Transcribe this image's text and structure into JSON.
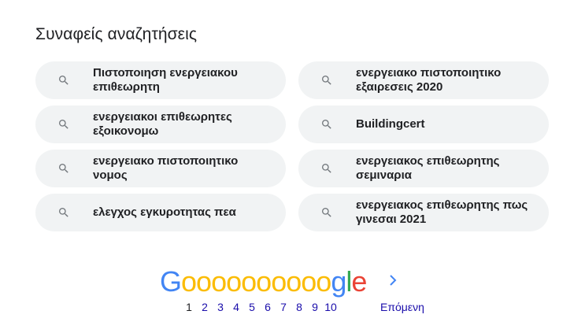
{
  "related": {
    "heading": "Συναφείς αναζητήσεις",
    "items": [
      {
        "label": "Πιστοποιηση ενεργειακου επιθεωρητη"
      },
      {
        "label": "ενεργειακο πιστοποιητικο εξαιρεσεις 2020"
      },
      {
        "label": "ενεργειακοι επιθεωρητες εξοικονομω"
      },
      {
        "label": "Buildingcert"
      },
      {
        "label": "ενεργειακο πιστοποιητικο νομος"
      },
      {
        "label": "ενεργειακος επιθεωρητης σεμιναρια"
      },
      {
        "label": "ελεγχος εγκυροτητας πεα"
      },
      {
        "label": "ενεργειακος επιθεωρητης πως γινεσαι 2021"
      }
    ],
    "icon": "search-icon"
  },
  "pagination": {
    "logo_letters": [
      {
        "ch": "G",
        "color": "#4285f4"
      },
      {
        "ch": "o",
        "color": "#fbbc05"
      },
      {
        "ch": "o",
        "color": "#fbbc05"
      },
      {
        "ch": "o",
        "color": "#fbbc05"
      },
      {
        "ch": "o",
        "color": "#fbbc05"
      },
      {
        "ch": "o",
        "color": "#fbbc05"
      },
      {
        "ch": "o",
        "color": "#fbbc05"
      },
      {
        "ch": "o",
        "color": "#fbbc05"
      },
      {
        "ch": "o",
        "color": "#fbbc05"
      },
      {
        "ch": "o",
        "color": "#fbbc05"
      },
      {
        "ch": "o",
        "color": "#fbbc05"
      },
      {
        "ch": "g",
        "color": "#4285f4"
      },
      {
        "ch": "l",
        "color": "#34a853"
      },
      {
        "ch": "e",
        "color": "#ea4335"
      }
    ],
    "pages": [
      "1",
      "2",
      "3",
      "4",
      "5",
      "6",
      "7",
      "8",
      "9",
      "10"
    ],
    "current_page": "1",
    "next_label": "Επόμενη",
    "next_icon": "chevron-right-icon"
  },
  "colors": {
    "chip_bg": "#f1f3f4",
    "link": "#1a0dab",
    "text": "#202124",
    "icon": "#70757a"
  }
}
